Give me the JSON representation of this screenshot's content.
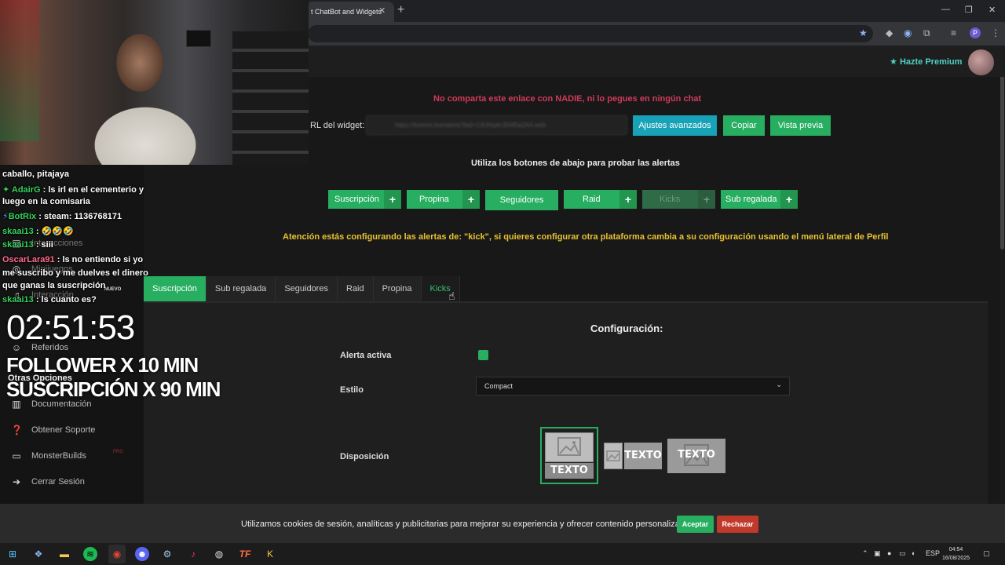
{
  "browser": {
    "tab_title": "t ChatBot and Widgets",
    "close": "✕",
    "new_tab": "+",
    "window_controls": [
      "—",
      "❐",
      "✕"
    ],
    "profile_initial": "P"
  },
  "header": {
    "premium_label": "Hazte Premium"
  },
  "widget": {
    "warning": "No comparta este enlace con NADIE, ni lo pegues en ningún chat",
    "url_label": "RL del widget:",
    "url_value": "https://kommi.live/alerts?bid=13UNq4c35M5a2A4.web",
    "buttons": {
      "advanced": "Ajustes avanzados",
      "copy": "Copiar",
      "preview": "Vista previa"
    },
    "test_hint": "Utiliza los botones de abajo para probar las alertas",
    "test_buttons": [
      "Suscripción",
      "Propina",
      "Seguidores",
      "Raid",
      "Kicks",
      "Sub regalada"
    ],
    "plus": "+",
    "platform_warning": "Atención estás configurando las alertas de: \"kick\", si quieres configurar otra plataforma cambia a su configuración usando el menú lateral de Perfil"
  },
  "config": {
    "tabs": [
      "Suscripción",
      "Sub regalada",
      "Seguidores",
      "Raid",
      "Propina",
      "Kicks"
    ],
    "title": "Configuración:",
    "active_label": "Alerta activa",
    "style_label": "Estilo",
    "style_value": "Compact",
    "layout_label": "Disposición",
    "layout_text": "TEXTO"
  },
  "sidebar": {
    "items": [
      "Interacciones",
      "Minijuegos",
      "Interacción",
      "Referidos",
      "Otras Opciones",
      "Documentación",
      "Obtener Soporte",
      "MonsterBuilds",
      "Cerrar Sesión"
    ],
    "badge_new": "NUEVO",
    "badge_pro": "PRO"
  },
  "chat": [
    {
      "user": "",
      "text": "caballo, pitajaya"
    },
    {
      "user": "AdairG",
      "text": ": ls irl en el cementerio y"
    },
    {
      "user": "",
      "text": "luego en la comisaria"
    },
    {
      "user": "BotRix",
      "text": ": steam: 1136768171"
    },
    {
      "user": "skaai13",
      "text": ": 🤣🤣🤣"
    },
    {
      "user": "skaai13",
      "text": ": siii"
    },
    {
      "user": "OscarLara91",
      "text": ": ls no entiendo si yo"
    },
    {
      "user": "",
      "text": "me suscribo y me duelves el dinero"
    },
    {
      "user": "",
      "text": "que ganas la suscripción"
    },
    {
      "user": "skaai13",
      "text": ": ls cuanto es?"
    }
  ],
  "overlay": {
    "timer": "02:51:53",
    "line1": "FOLLOWER X 10 MIN",
    "line2": "SUSCRIPCIÓN X 90 MIN"
  },
  "cookie": {
    "text": "Utilizamos cookies de sesión, analíticas y publicitarias para mejorar su experiencia y ofrecer contenido personalizado.",
    "accept": "Aceptar",
    "reject": "Rechazar"
  },
  "taskbar": {
    "lang": "ESP",
    "time": "04:54",
    "date": "16/08/2025"
  },
  "colors": {
    "accent": "#27ae60",
    "teal": "#17a2b8",
    "warn_red": "#d23a5a",
    "warn_yellow": "#e9c232",
    "reject": "#c0392b"
  }
}
